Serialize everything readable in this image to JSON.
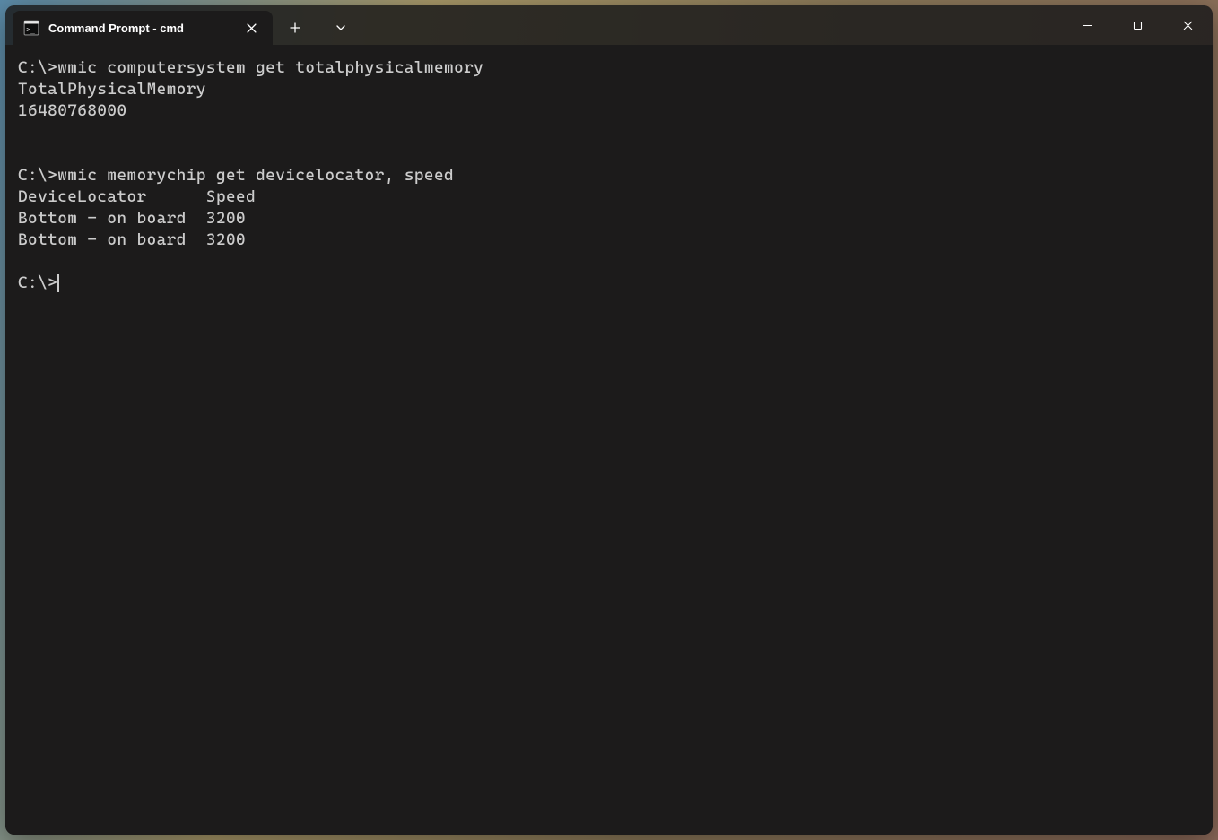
{
  "titlebar": {
    "tab_title": "Command Prompt - cmd",
    "tab_icon": "terminal-icon",
    "close_tab_icon": "close-icon",
    "new_tab_icon": "plus-icon",
    "dropdown_icon": "chevron-down-icon"
  },
  "window_controls": {
    "minimize": "minimize-icon",
    "maximize": "maximize-icon",
    "close": "close-icon"
  },
  "terminal": {
    "prompt": "C:\\>",
    "commands": [
      {
        "prompt": "C:\\>",
        "input": "wmic computersystem get totalphysicalmemory",
        "output": "TotalPhysicalMemory\n16480768000"
      },
      {
        "prompt": "C:\\>",
        "input": "wmic memorychip get devicelocator, speed",
        "output": "DeviceLocator      Speed\nBottom - on board  3200\nBottom - on board  3200"
      }
    ],
    "current_prompt": "C:\\>"
  },
  "rendered_text": "C:\\>wmic computersystem get totalphysicalmemory\nTotalPhysicalMemory\n16480768000\n\n\nC:\\>wmic memorychip get devicelocator, speed\nDeviceLocator      Speed\nBottom - on board  3200\nBottom - on board  3200\n\n",
  "colors": {
    "background": "#1c1b1b",
    "foreground": "#cccccc"
  }
}
